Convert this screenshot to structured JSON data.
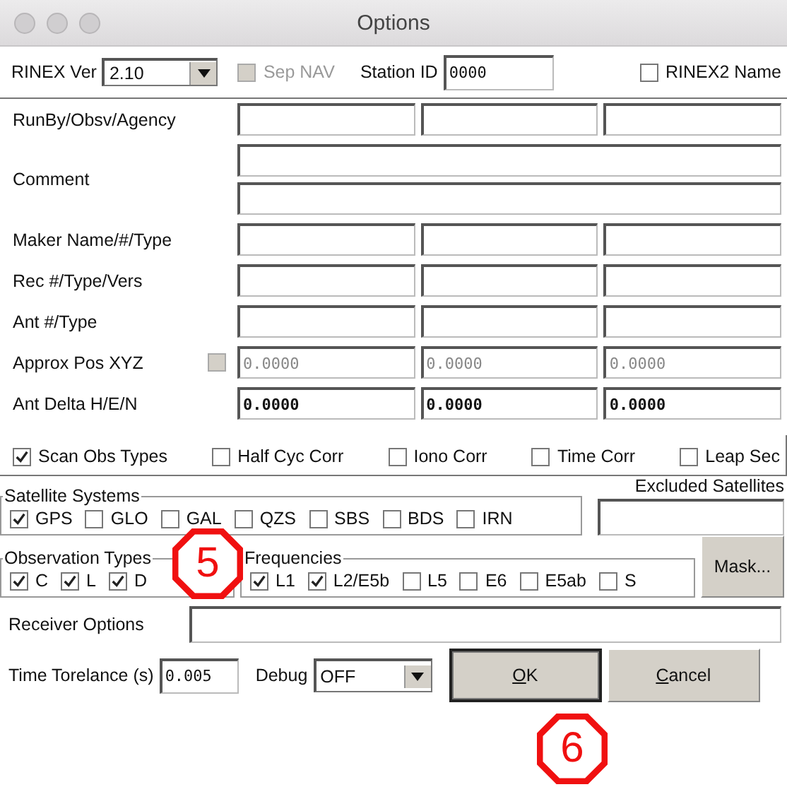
{
  "window": {
    "title": "Options"
  },
  "header": {
    "rinex_ver_label": "RINEX Ver",
    "rinex_ver": "2.10",
    "sep_nav": {
      "label": "Sep NAV",
      "checked": false,
      "disabled": true
    },
    "station_id_label": "Station ID",
    "station_id": "0000",
    "rinex2_name": {
      "label": "RINEX2 Name",
      "checked": false
    }
  },
  "rows": [
    {
      "label": "RunBy/Obsv/Agency",
      "kind": "triple"
    },
    {
      "label": "Comment",
      "kind": "double"
    },
    {
      "label": "Maker Name/#/Type",
      "kind": "triple"
    },
    {
      "label": "Rec #/Type/Vers",
      "kind": "triple"
    },
    {
      "label": "Ant #/Type",
      "kind": "triple"
    },
    {
      "label": "Approx Pos XYZ",
      "kind": "values",
      "checked": false,
      "disabled": true,
      "values": [
        "0.0000",
        "0.0000",
        "0.0000"
      ]
    },
    {
      "label": "Ant Delta H/E/N",
      "kind": "values",
      "disabled": false,
      "values": [
        "0.0000",
        "0.0000",
        "0.0000"
      ]
    }
  ],
  "options": [
    {
      "label": "Scan Obs Types",
      "checked": true
    },
    {
      "label": "Half Cyc Corr",
      "checked": false
    },
    {
      "label": "Iono Corr",
      "checked": false
    },
    {
      "label": "Time Corr",
      "checked": false
    },
    {
      "label": "Leap Sec",
      "checked": false
    }
  ],
  "satellite_systems": {
    "title": "Satellite Systems",
    "items": [
      {
        "label": "GPS",
        "checked": true
      },
      {
        "label": "GLO",
        "checked": false
      },
      {
        "label": "GAL",
        "checked": false
      },
      {
        "label": "QZS",
        "checked": false
      },
      {
        "label": "SBS",
        "checked": false
      },
      {
        "label": "BDS",
        "checked": false
      },
      {
        "label": "IRN",
        "checked": false
      }
    ]
  },
  "excluded_satellites": {
    "label": "Excluded Satellites"
  },
  "observation_types": {
    "title": "Observation Types",
    "items": [
      {
        "label": "C",
        "checked": true
      },
      {
        "label": "L",
        "checked": true
      },
      {
        "label": "D",
        "checked": true
      }
    ]
  },
  "frequencies": {
    "title": "Frequencies",
    "items": [
      {
        "label": "L1",
        "checked": true
      },
      {
        "label": "L2/E5b",
        "checked": true
      },
      {
        "label": "L5",
        "checked": false
      },
      {
        "label": "E6",
        "checked": false
      },
      {
        "label": "E5ab",
        "checked": false
      },
      {
        "label": "S",
        "checked": false
      }
    ]
  },
  "mask_button": "Mask...",
  "receiver_options": {
    "label": "Receiver Options"
  },
  "time_tolerance": {
    "label": "Time Torelance (s)",
    "value": "0.005"
  },
  "debug": {
    "label": "Debug",
    "value": "OFF"
  },
  "buttons": [
    {
      "label": "OK",
      "kind": "default"
    },
    {
      "label": "Cancel",
      "kind": "normal"
    }
  ],
  "callouts": [
    {
      "label": "5",
      "kind": "observation"
    },
    {
      "label": "6",
      "kind": "ok"
    }
  ]
}
